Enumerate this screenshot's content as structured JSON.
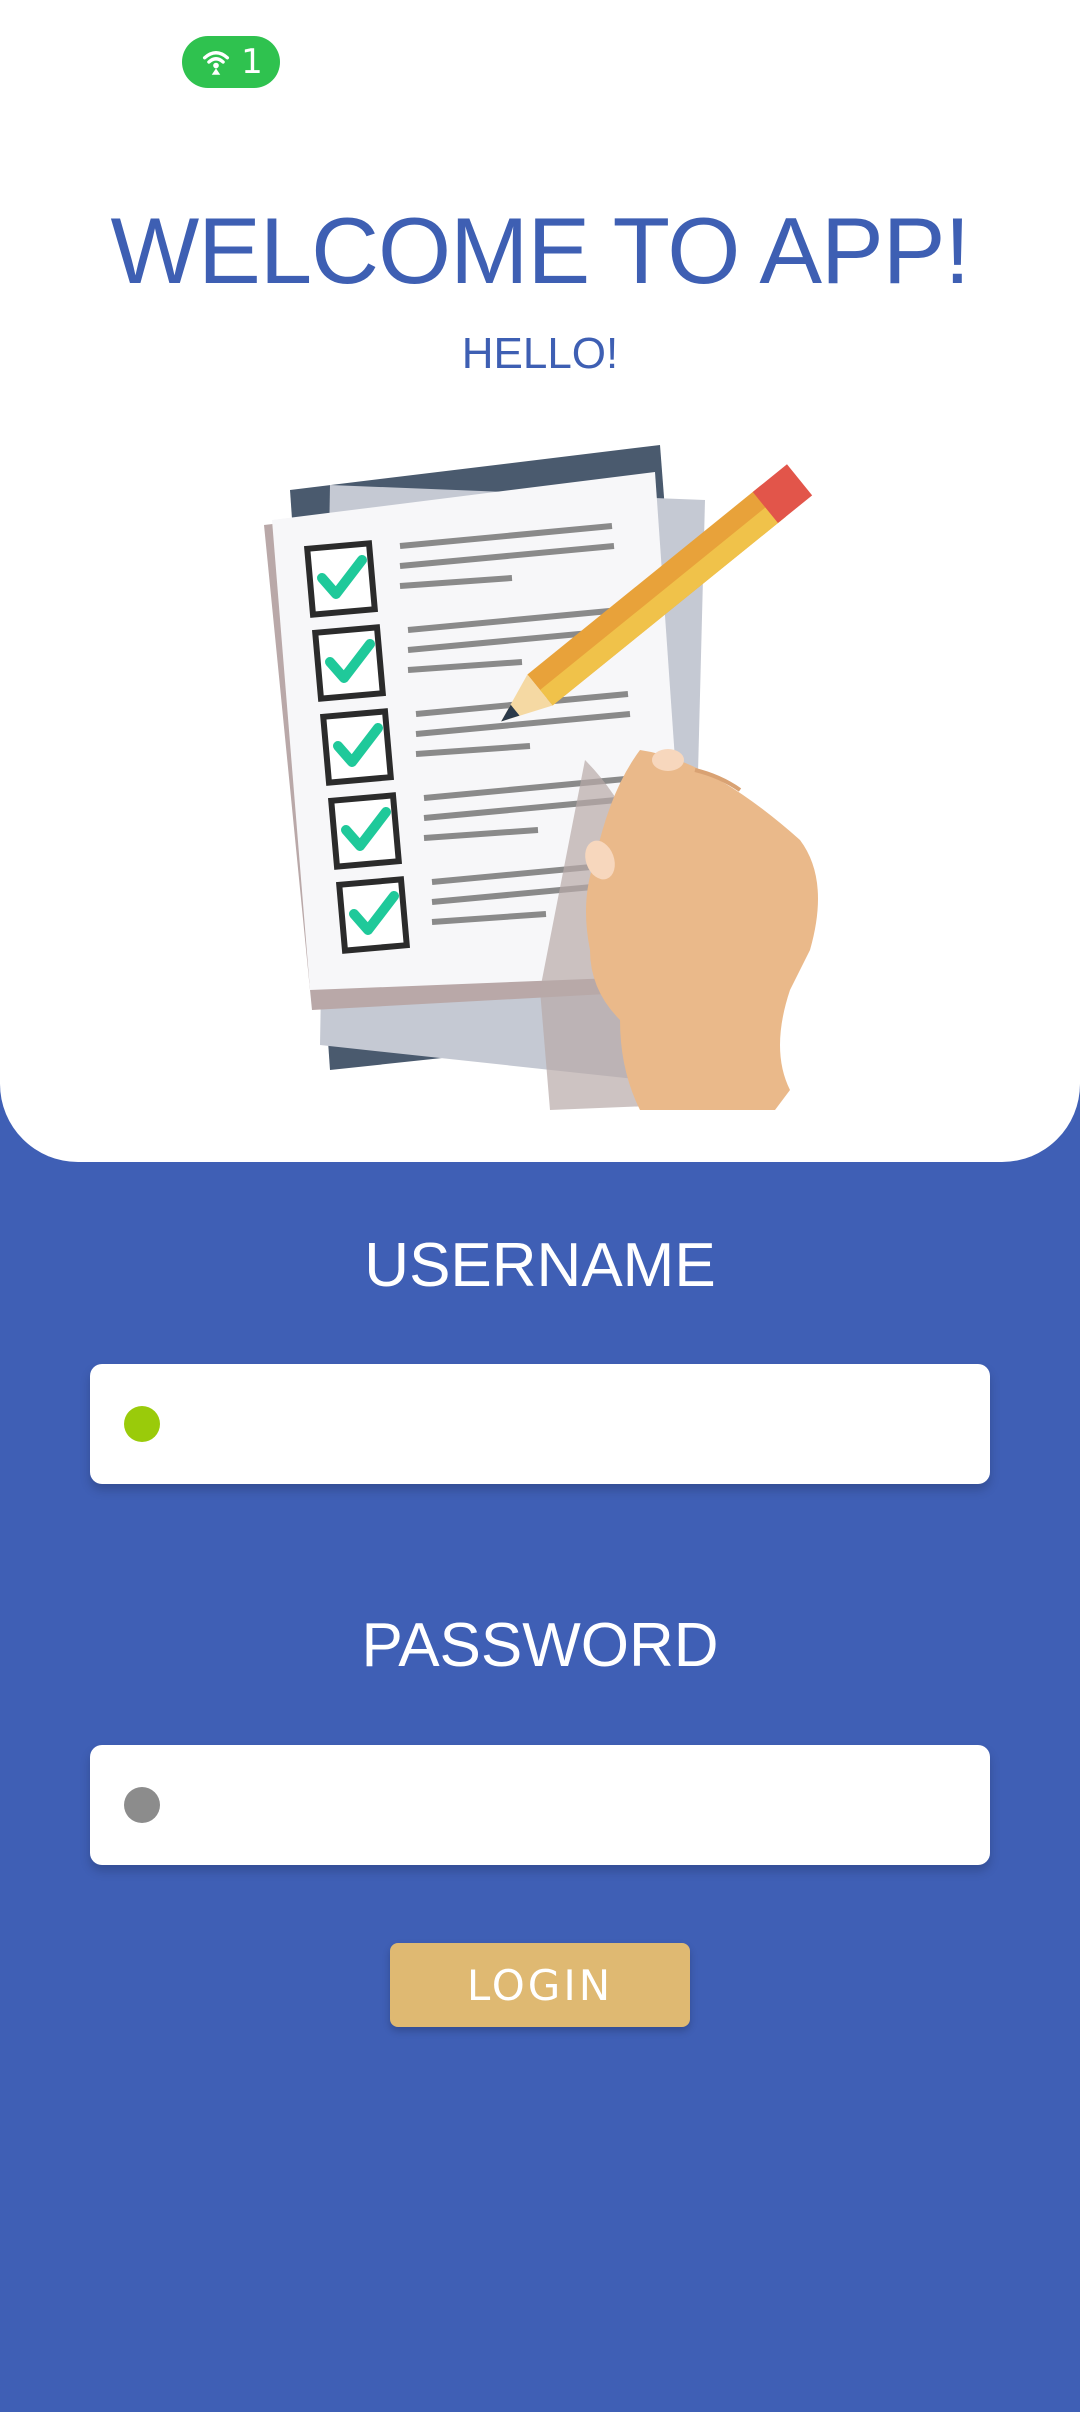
{
  "status": {
    "hotspot_count": "1",
    "hotspot_icon": "hotspot-icon",
    "pill_color": "#2fc24f"
  },
  "header": {
    "title": "WELCOME TO APP!",
    "subtitle": "HELLO!"
  },
  "illustration": {
    "icon": "checklist-with-pencil-illustration"
  },
  "form": {
    "username_label": "USERNAME",
    "username_value": "",
    "username_dot_color": "#9acb0a",
    "password_label": "PASSWORD",
    "password_value": "",
    "password_dot_color": "#8c8c8c",
    "login_label": "LOGIN"
  },
  "colors": {
    "background": "#3f5fb5",
    "accent_text": "#3e5fb3",
    "button": "#dfb972",
    "checkmark": "#1fc99a"
  }
}
